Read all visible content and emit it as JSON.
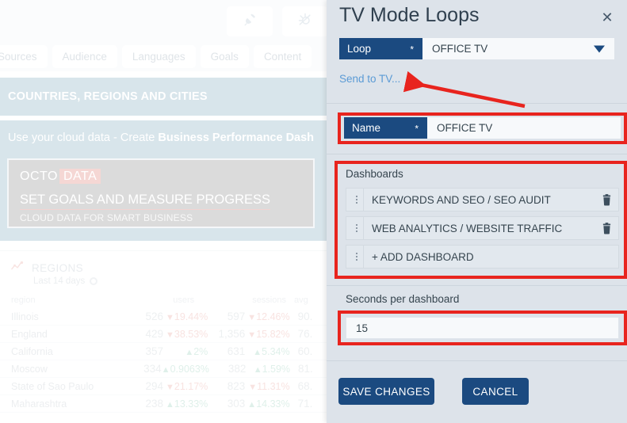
{
  "background": {
    "header_icons": [
      {
        "name": "plug-icon"
      },
      {
        "name": "broadcast-icon"
      }
    ],
    "tabs": [
      {
        "label": "Sources"
      },
      {
        "label": "Audience"
      },
      {
        "label": "Languages"
      },
      {
        "label": "Goals"
      },
      {
        "label": "Content"
      }
    ],
    "section_title": "COUNTRIES, REGIONS AND CITIES",
    "promo": {
      "text_plain": "Use your cloud data - Create ",
      "text_bold": "Business Performance Dash",
      "banner": {
        "brand_first": "OCTO",
        "brand_second": "DATA",
        "headline": "SET GOALS AND MEASURE PROGRESS",
        "subline": "CLOUD DATA FOR SMART BUSINESS"
      }
    },
    "card": {
      "title": "REGIONS",
      "subtitle": "Last 14 days",
      "columns": [
        "region",
        "users",
        "sessions",
        "avg"
      ],
      "rows": [
        {
          "region": "Illinois",
          "users": "526",
          "users_delta": "19.44%",
          "users_dir": "down",
          "sessions": "597",
          "sessions_delta": "12.46%",
          "sessions_dir": "down",
          "avg": "90."
        },
        {
          "region": "England",
          "users": "429",
          "users_delta": "38.53%",
          "users_dir": "down",
          "sessions": "1,356",
          "sessions_delta": "15.82%",
          "sessions_dir": "down",
          "avg": "76."
        },
        {
          "region": "California",
          "users": "357",
          "users_delta": "2%",
          "users_dir": "up",
          "sessions": "631",
          "sessions_delta": "5.34%",
          "sessions_dir": "up",
          "avg": "60."
        },
        {
          "region": "Moscow",
          "users": "334",
          "users_delta": "0.9063%",
          "users_dir": "up",
          "sessions": "382",
          "sessions_delta": "1.59%",
          "sessions_dir": "up",
          "avg": "81."
        },
        {
          "region": "State of Sao Paulo",
          "users": "294",
          "users_delta": "21.17%",
          "users_dir": "down",
          "sessions": "823",
          "sessions_delta": "11.31%",
          "sessions_dir": "down",
          "avg": "68."
        },
        {
          "region": "Maharashtra",
          "users": "238",
          "users_delta": "13.33%",
          "users_dir": "up",
          "sessions": "303",
          "sessions_delta": "14.33%",
          "sessions_dir": "up",
          "avg": "71."
        }
      ]
    }
  },
  "panel": {
    "title": "TV Mode Loops",
    "close_label": "✕",
    "loop": {
      "label": "Loop",
      "required_mark": "*",
      "value": "OFFICE TV"
    },
    "send_to_tv": "Send to TV...",
    "name": {
      "label": "Name",
      "required_mark": "*",
      "value": "OFFICE TV"
    },
    "dashboards": {
      "heading": "Dashboards",
      "items": [
        {
          "label": "KEYWORDS AND SEO / SEO AUDIT",
          "has_delete": true
        },
        {
          "label": "WEB ANALYTICS / WEBSITE TRAFFIC",
          "has_delete": true
        },
        {
          "label": "+ ADD DASHBOARD",
          "has_delete": false
        }
      ]
    },
    "seconds": {
      "label": "Seconds per dashboard",
      "value": "15"
    },
    "buttons": {
      "save": "SAVE CHANGES",
      "cancel": "CANCEL"
    }
  },
  "colors": {
    "accent_navy": "#1b4a80",
    "panel_bg": "#dde3ea",
    "annotation_red": "#e8241e",
    "link_blue": "#5b9bd5",
    "banner_teal": "#a9c6d2"
  }
}
